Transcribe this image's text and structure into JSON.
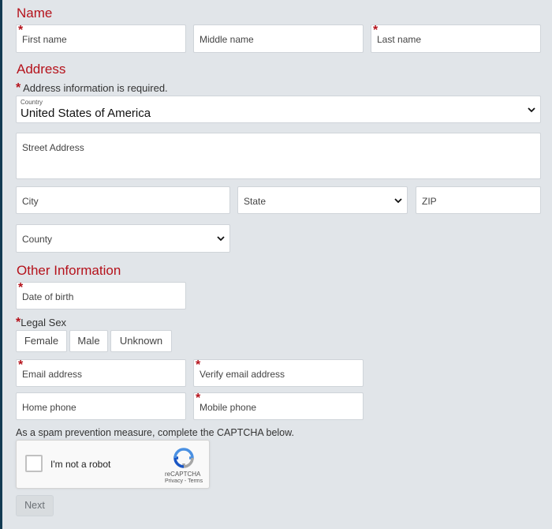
{
  "sections": {
    "name": "Name",
    "address": "Address",
    "other": "Other Information"
  },
  "required_marker": "*",
  "name_fields": {
    "first": "First name",
    "middle": "Middle name",
    "last": "Last name"
  },
  "address": {
    "required_note": "Address information is required.",
    "country_label": "Country",
    "country_value": "United States of America",
    "street": "Street Address",
    "city": "City",
    "state": "State",
    "zip": "ZIP",
    "county": "County"
  },
  "other": {
    "dob": "Date of birth",
    "legal_sex_label": "Legal Sex",
    "sex_options": [
      "Female",
      "Male",
      "Unknown"
    ],
    "email": "Email address",
    "verify_email": "Verify email address",
    "home_phone": "Home phone",
    "mobile_phone": "Mobile phone"
  },
  "captcha": {
    "instruction": "As a spam prevention measure, complete the CAPTCHA below.",
    "label": "I'm not a robot",
    "brand": "reCAPTCHA",
    "privacy": "Privacy",
    "separator": "-",
    "terms": "Terms"
  },
  "next_label": "Next",
  "colors": {
    "accent": "#b5121b",
    "background": "#e1e5e9",
    "border": "#cfd4d9"
  }
}
